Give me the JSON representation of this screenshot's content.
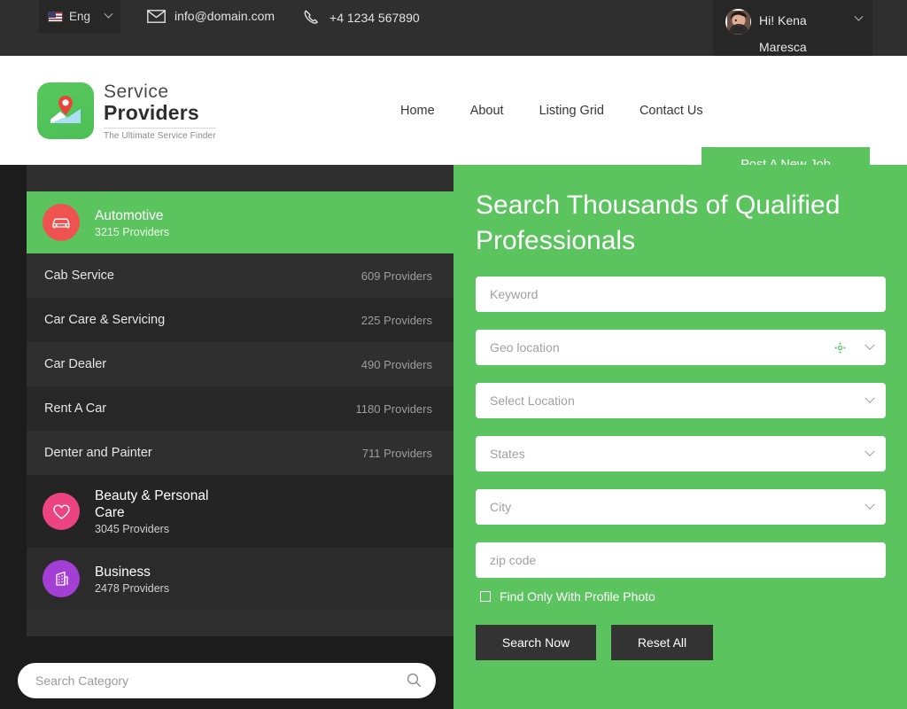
{
  "topbar": {
    "language": {
      "label": "Eng",
      "flag_icon": "us-flag-icon"
    },
    "email": "info@domain.com",
    "phone": "+4 1234 567890",
    "user_greeting": "Hi! Kena Maresca"
  },
  "header": {
    "logo": {
      "line1": "Service",
      "line2": "Providers",
      "tagline": "The Ultimate Service Finder"
    },
    "nav": [
      {
        "label": "Home"
      },
      {
        "label": "About"
      },
      {
        "label": "Listing Grid"
      },
      {
        "label": "Contact Us"
      }
    ],
    "cta_label": "Post A New Job"
  },
  "sidebar": {
    "categories": [
      {
        "title": "Automotive",
        "count": "3215 Providers",
        "icon": "car-icon",
        "badge_color": "#ef5350",
        "active": true,
        "subitems": [
          {
            "name": "Cab Service",
            "count": "609 Providers"
          },
          {
            "name": "Car Care & Servicing",
            "count": "225 Providers"
          },
          {
            "name": "Car Dealer",
            "count": "490 Providers"
          },
          {
            "name": "Rent A Car",
            "count": "1180 Providers"
          },
          {
            "name": "Denter and Painter",
            "count": "711 Providers"
          }
        ]
      },
      {
        "title": "Beauty & Personal Care",
        "count": "3045 Providers",
        "icon": "heart-icon",
        "badge_color": "#ec4480",
        "active": false,
        "subitems": []
      },
      {
        "title": "Business",
        "count": "2478 Providers",
        "icon": "building-icon",
        "badge_color": "#a43fd6",
        "active": false,
        "subitems": []
      }
    ],
    "search_placeholder": "Search Category",
    "search_value": "",
    "search_icon": "search-icon"
  },
  "search_panel": {
    "title": "Search Thousands of Qualified Professionals",
    "accent_color": "#5cc45f",
    "fields": [
      {
        "name": "keyword",
        "placeholder": "Keyword",
        "value": "",
        "type": "text"
      },
      {
        "name": "geo-location",
        "placeholder": "Geo location",
        "value": "",
        "type": "geo"
      },
      {
        "name": "select-location",
        "placeholder": "Select Location",
        "value": "",
        "type": "select"
      },
      {
        "name": "states",
        "placeholder": "States",
        "value": "",
        "type": "select"
      },
      {
        "name": "city",
        "placeholder": "City",
        "value": "",
        "type": "select"
      },
      {
        "name": "zip-code",
        "placeholder": "zip code",
        "value": "",
        "type": "text"
      }
    ],
    "checkbox_label": "Find Only With Profile Photo",
    "checkbox_checked": false,
    "search_button": "Search Now",
    "reset_button": "Reset All"
  }
}
